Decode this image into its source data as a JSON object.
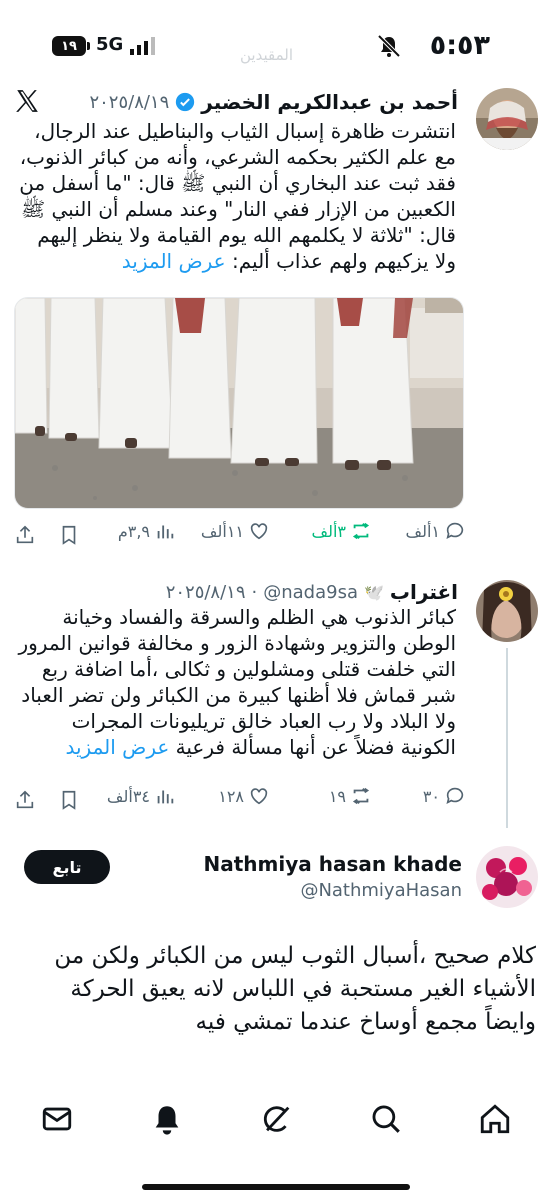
{
  "status_bar": {
    "time": "٥:٥٣",
    "network": "5G",
    "battery": "١٩"
  },
  "ghost_header": "المقيدين",
  "tweets": [
    {
      "author_name": "أحمد بن عبدالكريم الخضير",
      "date": "٢٠٢٥/٨/١٩",
      "text": "انتشرت ظاهرة إسبال الثياب والبناطيل عند الرجال، مع علم الكثير بحكمه الشرعي، وأنه من كبائر الذنوب، فقد ثبت عند البخاري أن النبي ﷺ  قال: \"ما أسفل من الكعبين من الإزار ففي النار\" وعند مسلم أن النبي ﷺ قال: \"ثلاثة لا يكلمهم الله يوم القيامة ولا ينظر إليهم ولا يزكيهم ولهم عذاب أليم: ",
      "show_more": "عرض المزيد",
      "replies": "١ألف",
      "retweets": "٣ألف",
      "likes": "١١ألف",
      "views": "٣,٩م"
    },
    {
      "author_name": "اغتراب",
      "emoji": "🕊️",
      "handle": "@nada9sa",
      "date": "٢٠٢٥/٨/١٩",
      "text": "كبائر الذنوب هي الظلم والسرقة والفساد وخيانة الوطن والتزوير وشهادة الزور و مخالفة قوانين المرور التي خلفت قتلى ومشلولين و ثكالى ،أما اضافة ربع شبر قماش فلا أظنها كبيرة من الكبائر ولن تضر العباد ولا البلاد ولا رب العباد خالق تريليونات المجرات الكونية فضلاً عن أنها مسألة فرعية ",
      "show_more": "عرض المزيد",
      "replies": "٣٠",
      "retweets": "١٩",
      "likes": "١٢٨",
      "views": "٣٤ألف"
    },
    {
      "author_name": "Nathmiya hasan khade",
      "handle": "@NathmiyaHasan",
      "follow_label": "تابع",
      "text": "كلام صحيح ،أسبال الثوب ليس من الكبائر ولكن من الأشياء الغير مستحبة في اللباس لانه يعيق الحركة وايضاً مجمع أوساخ عندما تمشي فيه"
    }
  ],
  "bottom_nav": [
    "home-icon",
    "search-icon",
    "grok-icon",
    "notifications-icon",
    "messages-icon"
  ],
  "colors": {
    "accent": "#1d9bf0",
    "retweet_active": "#00ba7c",
    "muted": "#536471"
  }
}
